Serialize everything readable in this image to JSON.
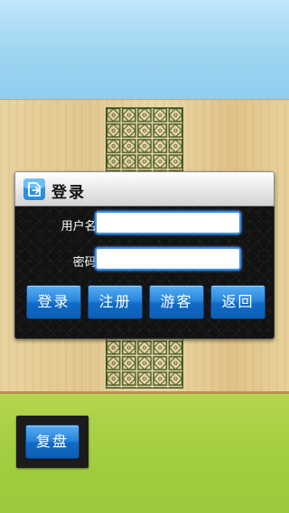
{
  "login_dialog": {
    "title": "登录",
    "username_label": "用户名:",
    "username_value": "",
    "password_label": "密码:",
    "password_value": "",
    "buttons": {
      "login": "登录",
      "register": "注册",
      "guest": "游客",
      "back": "返回"
    }
  },
  "replay_button": "复盘",
  "colors": {
    "sky": "#9ed5f1",
    "board": "#e5cc97",
    "grass": "#a6cf43",
    "button_blue": "#2a86dc",
    "pattern_green": "#3f5a2a",
    "dialog_body": "#121212"
  }
}
